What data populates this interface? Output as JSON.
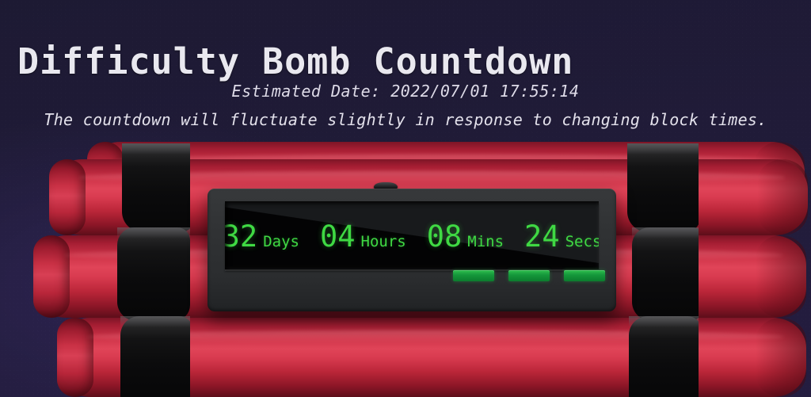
{
  "page": {
    "title": "Difficulty Bomb Countdown",
    "estimated_date_line": "Estimated Date: 2022/07/01 17:55:14",
    "note_line": "The countdown will fluctuate slightly in response to changing block times."
  },
  "countdown": {
    "days": {
      "value": "32",
      "label": "Days"
    },
    "hours": {
      "value": "04",
      "label": "Hours"
    },
    "mins": {
      "value": "08",
      "label": "Mins"
    },
    "secs": {
      "value": "24",
      "label": "Secs"
    }
  },
  "leds": [
    "led-1",
    "led-2",
    "led-3"
  ],
  "colors": {
    "background": "#1d1a33",
    "background_glow": "#3a2c66",
    "title_text": "#e9e8ef",
    "subtitle_text": "#dedbe8",
    "dynamite_red": "#d93b50",
    "dynamite_red_dark": "#7d1526",
    "tape_black": "#0b0b0c",
    "device_body": "#303234",
    "screen_black": "#050506",
    "digit_green": "#3fd943",
    "led_green": "#14963a"
  }
}
